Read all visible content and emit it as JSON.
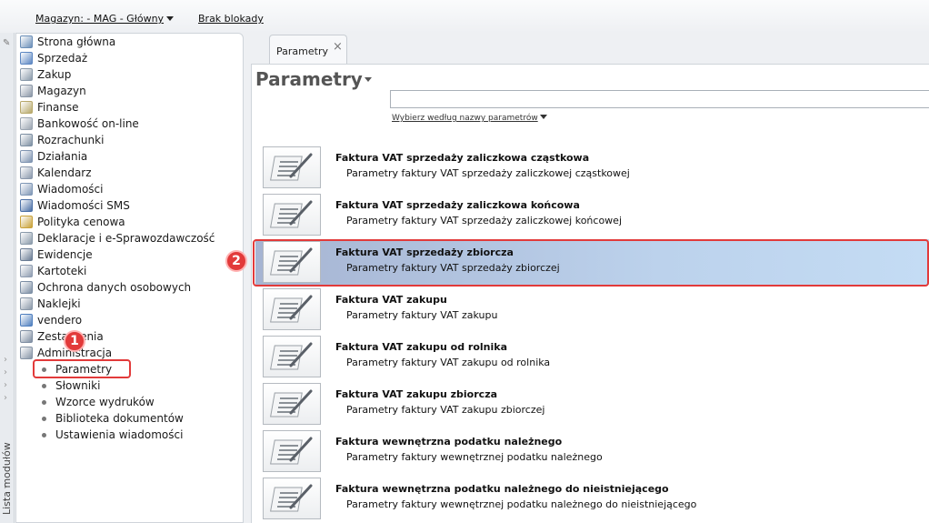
{
  "topbar": {
    "warehouse": "Magazyn: - MAG - Główny",
    "blocking": "Brak blokady"
  },
  "strip": {
    "label": "Lista modułów"
  },
  "sidebar": {
    "items": [
      {
        "label": "Strona główna",
        "icon": "home-icon",
        "color": "#6b8fb8"
      },
      {
        "label": "Sprzedaż",
        "icon": "sales-icon",
        "color": "#5b86c2"
      },
      {
        "label": "Zakup",
        "icon": "purchase-icon",
        "color": "#8a9aaa"
      },
      {
        "label": "Magazyn",
        "icon": "warehouse-icon",
        "color": "#8a96a6"
      },
      {
        "label": "Finanse",
        "icon": "finance-icon",
        "color": "#b7a86a"
      },
      {
        "label": "Bankowość on-line",
        "icon": "bank-icon",
        "color": "#9aa4b0"
      },
      {
        "label": "Rozrachunki",
        "icon": "settlements-icon",
        "color": "#7d8fa2"
      },
      {
        "label": "Działania",
        "icon": "actions-icon",
        "color": "#7e93b0"
      },
      {
        "label": "Kalendarz",
        "icon": "calendar-icon",
        "color": "#8a98ac"
      },
      {
        "label": "Wiadomości",
        "icon": "messages-icon",
        "color": "#7f97b6"
      },
      {
        "label": "Wiadomości SMS",
        "icon": "sms-icon",
        "color": "#4a6fa6"
      },
      {
        "label": "Polityka cenowa",
        "icon": "pricing-icon",
        "color": "#c9a23a"
      },
      {
        "label": "Deklaracje i e-Sprawozdawczość",
        "icon": "declarations-icon",
        "color": "#8a9aaa"
      },
      {
        "label": "Ewidencje",
        "icon": "records-icon",
        "color": "#6a7c94"
      },
      {
        "label": "Kartoteki",
        "icon": "files-icon",
        "color": "#8e9cb0"
      },
      {
        "label": "Ochrona danych osobowych",
        "icon": "data-protection-icon",
        "color": "#7b8da3"
      },
      {
        "label": "Naklejki",
        "icon": "stickers-icon",
        "color": "#8a98a8"
      },
      {
        "label": "vendero",
        "icon": "vendero-icon",
        "color": "#4f7fbf"
      },
      {
        "label": "Zestawienia",
        "icon": "reports-icon",
        "color": "#7f8ea2"
      },
      {
        "label": "Administracja",
        "icon": "admin-icon",
        "color": "#8694a6"
      }
    ],
    "sub_items": [
      {
        "label": "Parametry"
      },
      {
        "label": "Słowniki"
      },
      {
        "label": "Wzorce wydruków"
      },
      {
        "label": "Biblioteka dokumentów"
      },
      {
        "label": "Ustawienia wiadomości"
      }
    ]
  },
  "tab": {
    "label": "Parametry",
    "close": "×"
  },
  "main": {
    "title": "Parametry",
    "search": {
      "value": "",
      "placeholder": ""
    },
    "filter_label": "Wybierz według nazwy parametrów",
    "rows": [
      {
        "title": "Faktura VAT sprzedaży zaliczkowa cząstkowa",
        "desc": "Parametry faktury VAT sprzedaży zaliczkowej cząstkowej"
      },
      {
        "title": "Faktura VAT sprzedaży zaliczkowa końcowa",
        "desc": "Parametry faktury VAT sprzedaży zaliczkowej końcowej"
      },
      {
        "title": "Faktura VAT sprzedaży zbiorcza",
        "desc": "Parametry faktury VAT sprzedaży zbiorczej"
      },
      {
        "title": "Faktura VAT zakupu",
        "desc": "Parametry faktury VAT zakupu"
      },
      {
        "title": "Faktura VAT zakupu od rolnika",
        "desc": "Parametry faktury VAT zakupu od rolnika"
      },
      {
        "title": "Faktura VAT zakupu zbiorcza",
        "desc": "Parametry faktury VAT zakupu zbiorczej"
      },
      {
        "title": "Faktura wewnętrzna podatku należnego",
        "desc": "Parametry faktury wewnętrznej podatku należnego"
      },
      {
        "title": "Faktura wewnętrzna podatku należnego do nieistniejącego",
        "desc": "Parametry faktury wewnętrznej podatku należnego do nieistniejącego"
      }
    ]
  },
  "annotations": {
    "step1": "1",
    "step2": "2",
    "accent": "#e23a3a"
  }
}
